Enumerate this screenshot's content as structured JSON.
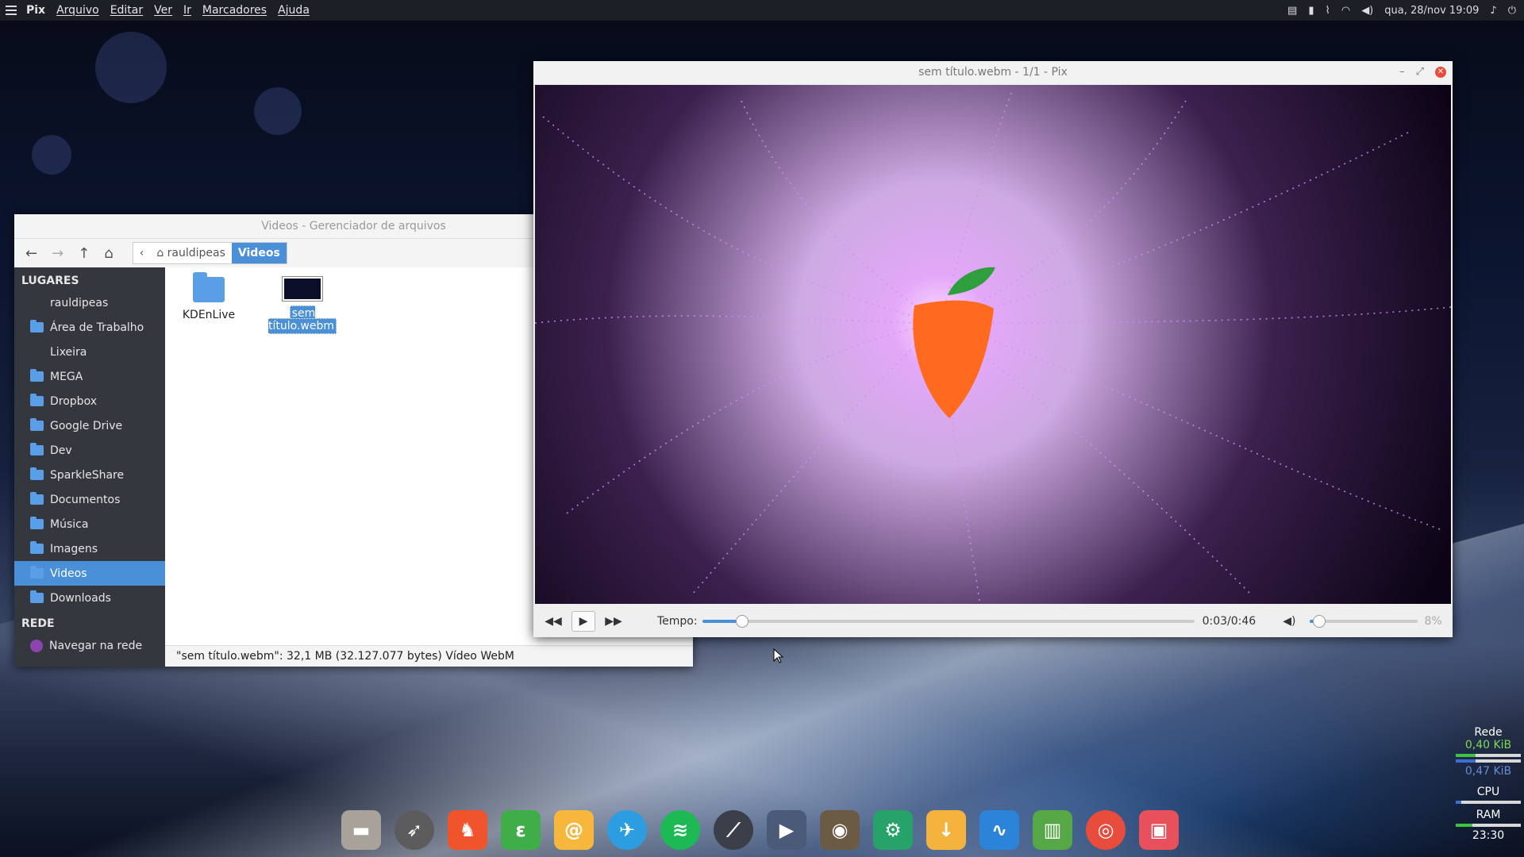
{
  "top_panel": {
    "app_name": "Pix",
    "menus": [
      "Arquivo",
      "Editar",
      "Ver",
      "Ir",
      "Marcadores",
      "Ajuda"
    ],
    "datetime": "qua, 28/nov 19:09"
  },
  "file_manager": {
    "title": "Videos - Gerenciador de arquivos",
    "breadcrumbs": [
      "rauldipeas",
      "Videos"
    ],
    "places_header": "LUGARES",
    "places": [
      "rauldipeas",
      "Área de Trabalho",
      "Lixeira",
      "MEGA",
      "Dropbox",
      "Google Drive",
      "Dev",
      "SparkleShare",
      "Documentos",
      "Música",
      "Imagens",
      "Videos",
      "Downloads"
    ],
    "network_header": "REDE",
    "network_items": [
      "Navegar na rede"
    ],
    "files": [
      "KDEnLive",
      "sem título.webm"
    ],
    "status": "\"sem título.webm\": 32,1 MB (32.127.077 bytes) Vídeo WebM"
  },
  "player": {
    "title": "sem título.webm - 1/1 - Pix",
    "time_label": "Tempo:",
    "time_current": "0:03",
    "time_total": "0:46",
    "time_sep": "/",
    "progress": 0.08,
    "volume_text": "8%",
    "volume": 0.08
  },
  "dock": {
    "icons": [
      "file-manager-icon",
      "rocket-icon",
      "brave-icon",
      "evernote-icon",
      "mail-icon",
      "finch-icon",
      "spotify-icon",
      "ardour-icon",
      "kdenlive-icon",
      "gimp-icon",
      "settings-icon",
      "download-icon",
      "audio-wave-icon",
      "trash-icon",
      "help-icon",
      "pix-icon"
    ]
  },
  "system_monitor": {
    "net_label": "Rede",
    "net_down": "0,40 KiB",
    "net_up": "0,47 KiB",
    "cpu_label": "CPU",
    "ram_label": "RAM",
    "clock": "23:30"
  }
}
